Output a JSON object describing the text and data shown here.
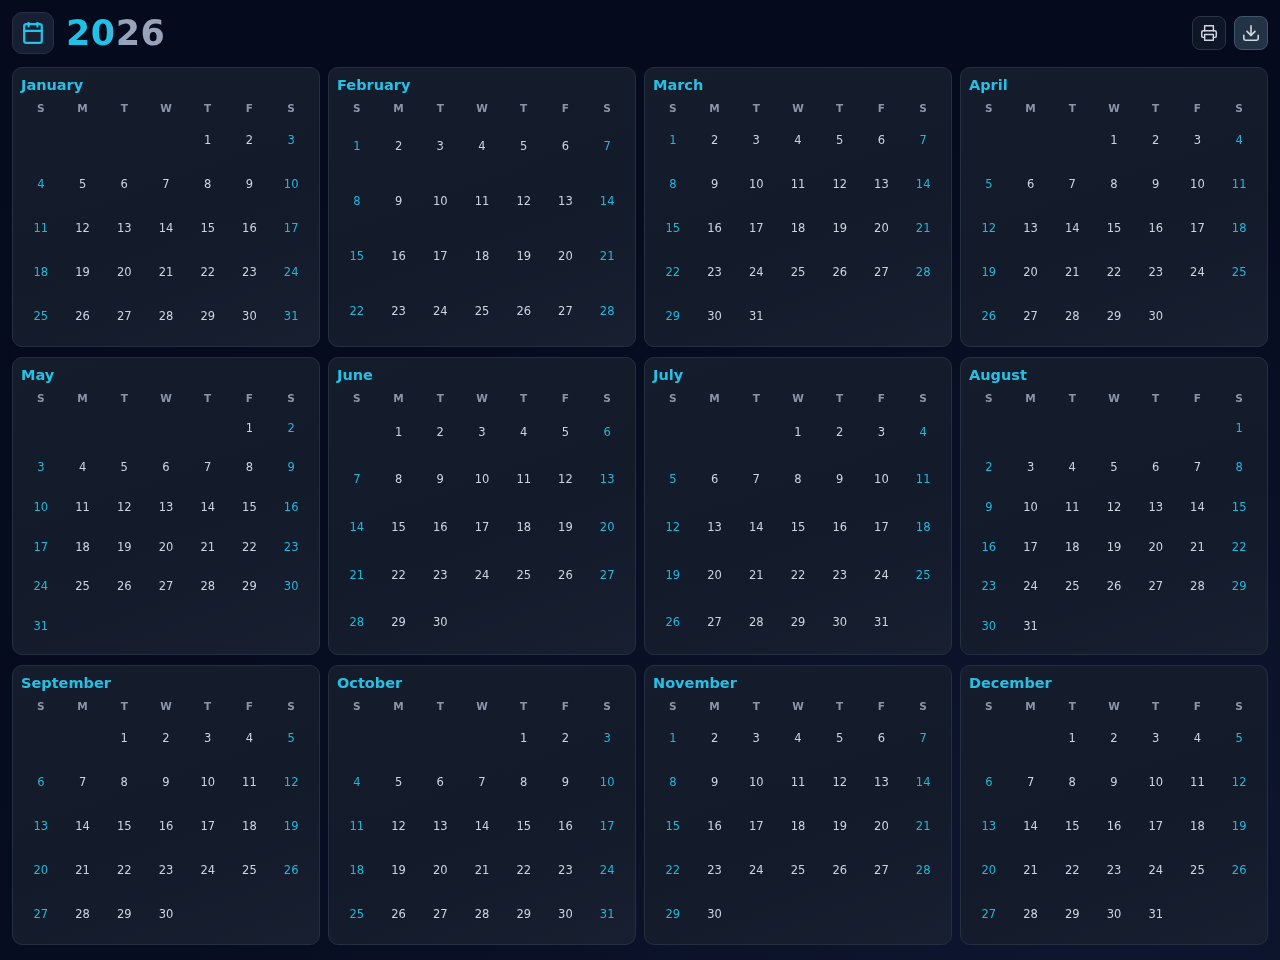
{
  "header": {
    "title": "2026",
    "actions": [
      {
        "kind": "print",
        "highlighted": false
      },
      {
        "kind": "download",
        "highlighted": true
      }
    ]
  },
  "months": [
    {
      "name": "January",
      "weekdays": [
        "S",
        "M",
        "T",
        "W",
        "T",
        "F",
        "S"
      ],
      "weeks": [
        [
          "1",
          "2",
          "3"
        ],
        [
          "4",
          "5",
          "6",
          "7",
          "8",
          "9",
          "10"
        ],
        [
          "11",
          "12",
          "13",
          "14",
          "15",
          "16",
          "17"
        ],
        [
          "18",
          "19",
          "20",
          "21",
          "22",
          "23",
          "24"
        ],
        [
          "25",
          "26",
          "27",
          "28",
          "29",
          "30",
          "31"
        ]
      ]
    },
    {
      "name": "February",
      "weekdays": [
        "S",
        "M",
        "T",
        "W",
        "T",
        "F",
        "S"
      ],
      "weeks": [
        [
          "1",
          "2",
          "3",
          "4",
          "5",
          "6",
          "7"
        ],
        [
          "8",
          "9",
          "10",
          "11",
          "12",
          "13",
          "14"
        ],
        [
          "15",
          "16",
          "17",
          "18",
          "19",
          "20",
          "21"
        ],
        [
          "22",
          "23",
          "24",
          "25",
          "26",
          "27",
          "28"
        ]
      ]
    },
    {
      "name": "March",
      "weekdays": [
        "S",
        "M",
        "T",
        "W",
        "T",
        "F",
        "S"
      ],
      "weeks": [
        [
          "1",
          "2",
          "3",
          "4",
          "5",
          "6",
          "7"
        ],
        [
          "8",
          "9",
          "10",
          "11",
          "12",
          "13",
          "14"
        ],
        [
          "15",
          "16",
          "17",
          "18",
          "19",
          "20",
          "21"
        ],
        [
          "22",
          "23",
          "24",
          "25",
          "26",
          "27",
          "28"
        ],
        [
          "29",
          "30",
          "31"
        ]
      ]
    },
    {
      "name": "April",
      "weekdays": [
        "S",
        "M",
        "T",
        "W",
        "T",
        "F",
        "S"
      ],
      "weeks": [
        [
          "1",
          "2",
          "3",
          "4"
        ],
        [
          "5",
          "6",
          "7",
          "8",
          "9",
          "10",
          "11"
        ],
        [
          "12",
          "13",
          "14",
          "15",
          "16",
          "17",
          "18"
        ],
        [
          "19",
          "20",
          "21",
          "22",
          "23",
          "24",
          "25"
        ],
        [
          "26",
          "27",
          "28",
          "29",
          "30"
        ]
      ]
    },
    {
      "name": "May",
      "weekdays": [
        "S",
        "M",
        "T",
        "W",
        "T",
        "F",
        "S"
      ],
      "weeks": [
        [
          "1",
          "2"
        ],
        [
          "3",
          "4",
          "5",
          "6",
          "7",
          "8",
          "9"
        ],
        [
          "10",
          "11",
          "12",
          "13",
          "14",
          "15",
          "16"
        ],
        [
          "17",
          "18",
          "19",
          "20",
          "21",
          "22",
          "23"
        ],
        [
          "24",
          "25",
          "26",
          "27",
          "28",
          "29",
          "30"
        ],
        [
          "31"
        ]
      ]
    },
    {
      "name": "June",
      "weekdays": [
        "S",
        "M",
        "T",
        "W",
        "T",
        "F",
        "S"
      ],
      "weeks": [
        [
          "1",
          "2",
          "3",
          "4",
          "5",
          "6"
        ],
        [
          "7",
          "8",
          "9",
          "10",
          "11",
          "12",
          "13"
        ],
        [
          "14",
          "15",
          "16",
          "17",
          "18",
          "19",
          "20"
        ],
        [
          "21",
          "22",
          "23",
          "24",
          "25",
          "26",
          "27"
        ],
        [
          "28",
          "29",
          "30"
        ]
      ]
    },
    {
      "name": "July",
      "weekdays": [
        "S",
        "M",
        "T",
        "W",
        "T",
        "F",
        "S"
      ],
      "weeks": [
        [
          "1",
          "2",
          "3",
          "4"
        ],
        [
          "5",
          "6",
          "7",
          "8",
          "9",
          "10",
          "11"
        ],
        [
          "12",
          "13",
          "14",
          "15",
          "16",
          "17",
          "18"
        ],
        [
          "19",
          "20",
          "21",
          "22",
          "23",
          "24",
          "25"
        ],
        [
          "26",
          "27",
          "28",
          "29",
          "30",
          "31"
        ]
      ]
    },
    {
      "name": "August",
      "weekdays": [
        "S",
        "M",
        "T",
        "W",
        "T",
        "F",
        "S"
      ],
      "weeks": [
        [
          "1"
        ],
        [
          "2",
          "3",
          "4",
          "5",
          "6",
          "7",
          "8"
        ],
        [
          "9",
          "10",
          "11",
          "12",
          "13",
          "14",
          "15"
        ],
        [
          "16",
          "17",
          "18",
          "19",
          "20",
          "21",
          "22"
        ],
        [
          "23",
          "24",
          "25",
          "26",
          "27",
          "28",
          "29"
        ],
        [
          "30",
          "31"
        ]
      ]
    },
    {
      "name": "September",
      "weekdays": [
        "S",
        "M",
        "T",
        "W",
        "T",
        "F",
        "S"
      ],
      "weeks": [
        [
          "1",
          "2",
          "3",
          "4",
          "5"
        ],
        [
          "6",
          "7",
          "8",
          "9",
          "10",
          "11",
          "12"
        ],
        [
          "13",
          "14",
          "15",
          "16",
          "17",
          "18",
          "19"
        ],
        [
          "20",
          "21",
          "22",
          "23",
          "24",
          "25",
          "26"
        ],
        [
          "27",
          "28",
          "29",
          "30"
        ]
      ]
    },
    {
      "name": "October",
      "weekdays": [
        "S",
        "M",
        "T",
        "W",
        "T",
        "F",
        "S"
      ],
      "weeks": [
        [
          "1",
          "2",
          "3"
        ],
        [
          "4",
          "5",
          "6",
          "7",
          "8",
          "9",
          "10"
        ],
        [
          "11",
          "12",
          "13",
          "14",
          "15",
          "16",
          "17"
        ],
        [
          "18",
          "19",
          "20",
          "21",
          "22",
          "23",
          "24"
        ],
        [
          "25",
          "26",
          "27",
          "28",
          "29",
          "30",
          "31"
        ]
      ]
    },
    {
      "name": "November",
      "weekdays": [
        "S",
        "M",
        "T",
        "W",
        "T",
        "F",
        "S"
      ],
      "weeks": [
        [
          "1",
          "2",
          "3",
          "4",
          "5",
          "6",
          "7"
        ],
        [
          "8",
          "9",
          "10",
          "11",
          "12",
          "13",
          "14"
        ],
        [
          "15",
          "16",
          "17",
          "18",
          "19",
          "20",
          "21"
        ],
        [
          "22",
          "23",
          "24",
          "25",
          "26",
          "27",
          "28"
        ],
        [
          "29",
          "30"
        ]
      ]
    },
    {
      "name": "December",
      "weekdays": [
        "S",
        "M",
        "T",
        "W",
        "T",
        "F",
        "S"
      ],
      "weeks": [
        [
          "1",
          "2",
          "3",
          "4",
          "5"
        ],
        [
          "6",
          "7",
          "8",
          "9",
          "10",
          "11",
          "12"
        ],
        [
          "13",
          "14",
          "15",
          "16",
          "17",
          "18",
          "19"
        ],
        [
          "20",
          "21",
          "22",
          "23",
          "24",
          "25",
          "26"
        ],
        [
          "27",
          "28",
          "29",
          "30",
          "31"
        ]
      ]
    }
  ]
}
